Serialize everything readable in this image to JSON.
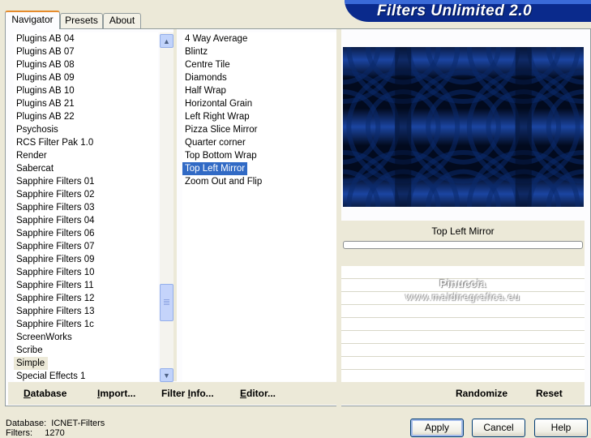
{
  "header": {
    "title": "Filters Unlimited 2.0"
  },
  "tabs": [
    {
      "label": "Navigator",
      "active": true
    },
    {
      "label": "Presets",
      "active": false
    },
    {
      "label": "About",
      "active": false
    }
  ],
  "categories": [
    "Plugins AB 04",
    "Plugins AB 07",
    "Plugins AB 08",
    "Plugins AB 09",
    "Plugins AB 10",
    "Plugins AB 21",
    "Plugins AB 22",
    "Psychosis",
    "RCS Filter Pak 1.0",
    "Render",
    "Sabercat",
    "Sapphire Filters 01",
    "Sapphire Filters 02",
    "Sapphire Filters 03",
    "Sapphire Filters 04",
    "Sapphire Filters 06",
    "Sapphire Filters 07",
    "Sapphire Filters 09",
    "Sapphire Filters 10",
    "Sapphire Filters 11",
    "Sapphire Filters 12",
    "Sapphire Filters 13",
    "Sapphire Filters 1c",
    "ScreenWorks",
    "Scribe",
    "Simple",
    "Special Effects 1"
  ],
  "selected_category": "Simple",
  "filters": [
    "4 Way Average",
    "Blintz",
    "Centre Tile",
    "Diamonds",
    "Half Wrap",
    "Horizontal Grain",
    "Left Right Wrap",
    "Pizza Slice Mirror",
    "Quarter corner",
    "Top Bottom Wrap",
    "Top Left Mirror",
    "Zoom Out and Flip"
  ],
  "selected_filter": "Top Left Mirror",
  "preview": {
    "selected_name": "Top Left Mirror",
    "watermark_line1": "Pinuccia",
    "watermark_line2": "www.maldiregrafica.eu",
    "colors": {
      "dark": "#020a1e",
      "mid": "#0b2a6b",
      "bright": "#1f4fb8"
    }
  },
  "left_buttons": [
    {
      "name": "database",
      "hot": "D",
      "rest": "atabase"
    },
    {
      "name": "import",
      "hot": "I",
      "rest": "mport..."
    },
    {
      "name": "filter-info",
      "pre": "Filter ",
      "hot": "I",
      "rest": "nfo..."
    },
    {
      "name": "editor",
      "hot": "E",
      "rest": "ditor..."
    }
  ],
  "right_buttons": {
    "randomize": "Randomize",
    "reset": "Reset"
  },
  "footer": {
    "database_label": "Database:",
    "database_value": "ICNET-Filters",
    "filters_label": "Filters:",
    "filters_value": "1270"
  },
  "dialog_buttons": {
    "apply": "Apply",
    "cancel": "Cancel",
    "help": "Help"
  },
  "accent_colors": {
    "selection": "#316ac5",
    "banner": "#0a2a8c"
  }
}
